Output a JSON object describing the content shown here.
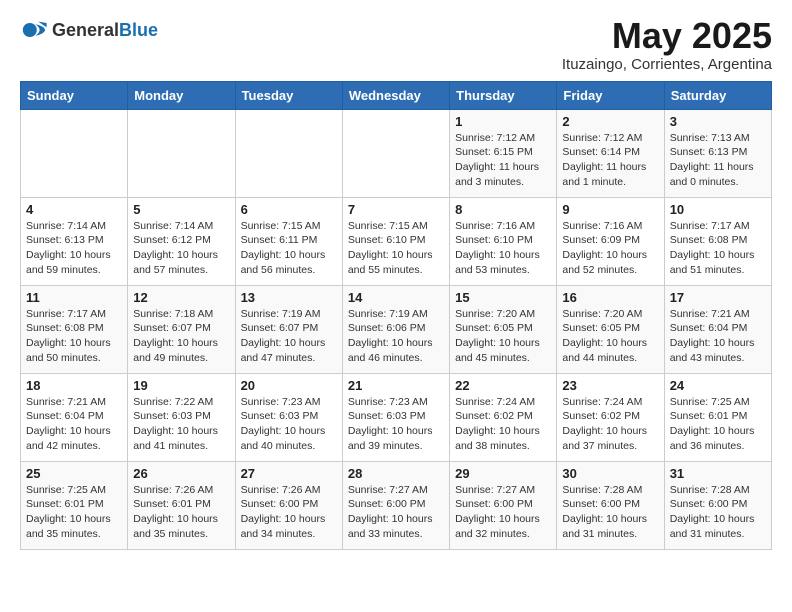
{
  "header": {
    "logo_general": "General",
    "logo_blue": "Blue",
    "month_title": "May 2025",
    "location": "Ituzaingo, Corrientes, Argentina"
  },
  "weekdays": [
    "Sunday",
    "Monday",
    "Tuesday",
    "Wednesday",
    "Thursday",
    "Friday",
    "Saturday"
  ],
  "weeks": [
    [
      {
        "day": "",
        "info": ""
      },
      {
        "day": "",
        "info": ""
      },
      {
        "day": "",
        "info": ""
      },
      {
        "day": "",
        "info": ""
      },
      {
        "day": "1",
        "info": "Sunrise: 7:12 AM\nSunset: 6:15 PM\nDaylight: 11 hours\nand 3 minutes."
      },
      {
        "day": "2",
        "info": "Sunrise: 7:12 AM\nSunset: 6:14 PM\nDaylight: 11 hours\nand 1 minute."
      },
      {
        "day": "3",
        "info": "Sunrise: 7:13 AM\nSunset: 6:13 PM\nDaylight: 11 hours\nand 0 minutes."
      }
    ],
    [
      {
        "day": "4",
        "info": "Sunrise: 7:14 AM\nSunset: 6:13 PM\nDaylight: 10 hours\nand 59 minutes."
      },
      {
        "day": "5",
        "info": "Sunrise: 7:14 AM\nSunset: 6:12 PM\nDaylight: 10 hours\nand 57 minutes."
      },
      {
        "day": "6",
        "info": "Sunrise: 7:15 AM\nSunset: 6:11 PM\nDaylight: 10 hours\nand 56 minutes."
      },
      {
        "day": "7",
        "info": "Sunrise: 7:15 AM\nSunset: 6:10 PM\nDaylight: 10 hours\nand 55 minutes."
      },
      {
        "day": "8",
        "info": "Sunrise: 7:16 AM\nSunset: 6:10 PM\nDaylight: 10 hours\nand 53 minutes."
      },
      {
        "day": "9",
        "info": "Sunrise: 7:16 AM\nSunset: 6:09 PM\nDaylight: 10 hours\nand 52 minutes."
      },
      {
        "day": "10",
        "info": "Sunrise: 7:17 AM\nSunset: 6:08 PM\nDaylight: 10 hours\nand 51 minutes."
      }
    ],
    [
      {
        "day": "11",
        "info": "Sunrise: 7:17 AM\nSunset: 6:08 PM\nDaylight: 10 hours\nand 50 minutes."
      },
      {
        "day": "12",
        "info": "Sunrise: 7:18 AM\nSunset: 6:07 PM\nDaylight: 10 hours\nand 49 minutes."
      },
      {
        "day": "13",
        "info": "Sunrise: 7:19 AM\nSunset: 6:07 PM\nDaylight: 10 hours\nand 47 minutes."
      },
      {
        "day": "14",
        "info": "Sunrise: 7:19 AM\nSunset: 6:06 PM\nDaylight: 10 hours\nand 46 minutes."
      },
      {
        "day": "15",
        "info": "Sunrise: 7:20 AM\nSunset: 6:05 PM\nDaylight: 10 hours\nand 45 minutes."
      },
      {
        "day": "16",
        "info": "Sunrise: 7:20 AM\nSunset: 6:05 PM\nDaylight: 10 hours\nand 44 minutes."
      },
      {
        "day": "17",
        "info": "Sunrise: 7:21 AM\nSunset: 6:04 PM\nDaylight: 10 hours\nand 43 minutes."
      }
    ],
    [
      {
        "day": "18",
        "info": "Sunrise: 7:21 AM\nSunset: 6:04 PM\nDaylight: 10 hours\nand 42 minutes."
      },
      {
        "day": "19",
        "info": "Sunrise: 7:22 AM\nSunset: 6:03 PM\nDaylight: 10 hours\nand 41 minutes."
      },
      {
        "day": "20",
        "info": "Sunrise: 7:23 AM\nSunset: 6:03 PM\nDaylight: 10 hours\nand 40 minutes."
      },
      {
        "day": "21",
        "info": "Sunrise: 7:23 AM\nSunset: 6:03 PM\nDaylight: 10 hours\nand 39 minutes."
      },
      {
        "day": "22",
        "info": "Sunrise: 7:24 AM\nSunset: 6:02 PM\nDaylight: 10 hours\nand 38 minutes."
      },
      {
        "day": "23",
        "info": "Sunrise: 7:24 AM\nSunset: 6:02 PM\nDaylight: 10 hours\nand 37 minutes."
      },
      {
        "day": "24",
        "info": "Sunrise: 7:25 AM\nSunset: 6:01 PM\nDaylight: 10 hours\nand 36 minutes."
      }
    ],
    [
      {
        "day": "25",
        "info": "Sunrise: 7:25 AM\nSunset: 6:01 PM\nDaylight: 10 hours\nand 35 minutes."
      },
      {
        "day": "26",
        "info": "Sunrise: 7:26 AM\nSunset: 6:01 PM\nDaylight: 10 hours\nand 35 minutes."
      },
      {
        "day": "27",
        "info": "Sunrise: 7:26 AM\nSunset: 6:00 PM\nDaylight: 10 hours\nand 34 minutes."
      },
      {
        "day": "28",
        "info": "Sunrise: 7:27 AM\nSunset: 6:00 PM\nDaylight: 10 hours\nand 33 minutes."
      },
      {
        "day": "29",
        "info": "Sunrise: 7:27 AM\nSunset: 6:00 PM\nDaylight: 10 hours\nand 32 minutes."
      },
      {
        "day": "30",
        "info": "Sunrise: 7:28 AM\nSunset: 6:00 PM\nDaylight: 10 hours\nand 31 minutes."
      },
      {
        "day": "31",
        "info": "Sunrise: 7:28 AM\nSunset: 6:00 PM\nDaylight: 10 hours\nand 31 minutes."
      }
    ]
  ]
}
